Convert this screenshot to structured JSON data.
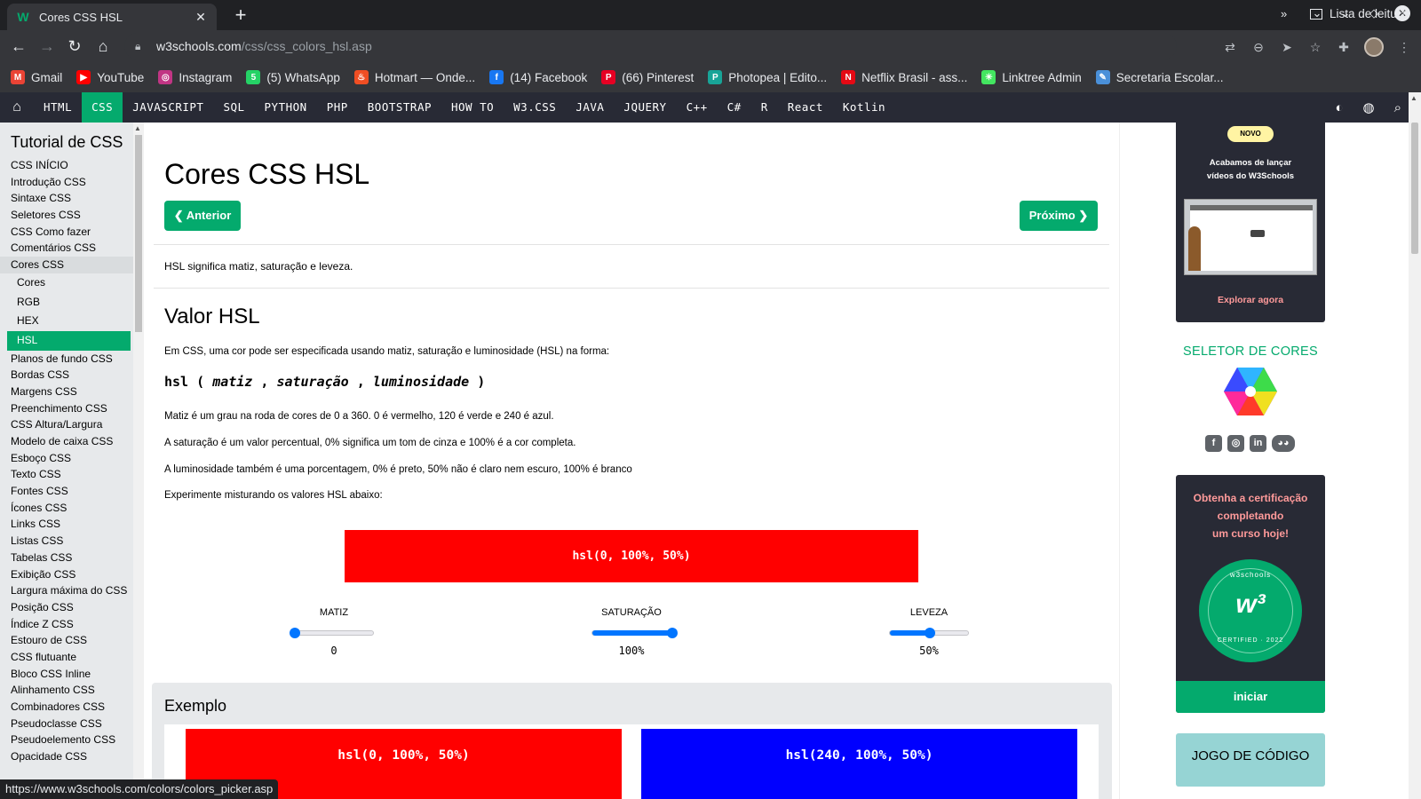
{
  "browser": {
    "tab_title": "Cores CSS HSL",
    "tab_favicon": "W",
    "url_host": "w3schools.com",
    "url_path": "/css/css_colors_hsl.asp",
    "status_url": "https://www.w3schools.com/colors/colors_picker.asp"
  },
  "bookmarks": [
    {
      "label": "Gmail",
      "icon": "gmail-icon",
      "color": "#ea4335",
      "glyph": "M"
    },
    {
      "label": "YouTube",
      "icon": "youtube-icon",
      "color": "#ff0000",
      "glyph": "▶"
    },
    {
      "label": "Instagram",
      "icon": "instagram-icon",
      "color": "#c13584",
      "glyph": "◎"
    },
    {
      "label": "(5) WhatsApp",
      "icon": "whatsapp-icon",
      "color": "#25d366",
      "glyph": "5"
    },
    {
      "label": "Hotmart — Onde...",
      "icon": "hotmart-icon",
      "color": "#f04e23",
      "glyph": "♨"
    },
    {
      "label": "(14) Facebook",
      "icon": "facebook-icon",
      "color": "#1877f2",
      "glyph": "f"
    },
    {
      "label": "(66) Pinterest",
      "icon": "pinterest-icon",
      "color": "#e60023",
      "glyph": "P"
    },
    {
      "label": "Photopea | Edito...",
      "icon": "photopea-icon",
      "color": "#18a497",
      "glyph": "P"
    },
    {
      "label": "Netflix Brasil - ass...",
      "icon": "netflix-icon",
      "color": "#e50914",
      "glyph": "N"
    },
    {
      "label": "Linktree Admin",
      "icon": "linktree-icon",
      "color": "#43e660",
      "glyph": "✳"
    },
    {
      "label": "Secretaria Escolar...",
      "icon": "secretaria-icon",
      "color": "#4a90d9",
      "glyph": "✎"
    }
  ],
  "bookmarks_more": "»",
  "reading_list": "Lista de leitura",
  "w3nav": [
    "HTML",
    "CSS",
    "JAVASCRIPT",
    "SQL",
    "PYTHON",
    "PHP",
    "BOOTSTRAP",
    "HOW TO",
    "W3.CSS",
    "JAVA",
    "JQUERY",
    "C++",
    "C#",
    "R",
    "React",
    "Kotlin"
  ],
  "sidebar": {
    "heading": "Tutorial de CSS",
    "items_before": [
      "CSS INÍCIO",
      "Introdução CSS",
      "Sintaxe CSS",
      "Seletores CSS",
      "CSS Como fazer",
      "Comentários CSS"
    ],
    "open_item": "Cores CSS",
    "sub_items": [
      "Cores",
      "RGB",
      "HEX",
      "HSL"
    ],
    "selected_sub": "HSL",
    "items_after": [
      "Planos de fundo CSS",
      "Bordas CSS",
      "Margens CSS",
      "Preenchimento CSS",
      "CSS Altura/Largura",
      "Modelo de caixa CSS",
      "Esboço CSS",
      "Texto CSS",
      "Fontes CSS",
      "Ícones CSS",
      "Links CSS",
      "Listas CSS",
      "Tabelas CSS",
      "Exibição CSS",
      "Largura máxima do CSS",
      "Posição CSS",
      "Índice Z CSS",
      "Estouro de CSS",
      "CSS flutuante",
      "Bloco CSS Inline",
      "Alinhamento CSS",
      "Combinadores CSS",
      "Pseudoclasse CSS",
      "Pseudoelemento CSS",
      "Opacidade CSS"
    ]
  },
  "main": {
    "title": "Cores CSS HSL",
    "prev_label": "❮ Anterior",
    "next_label": "Próximo ❯",
    "intro": "HSL significa matiz, saturação e leveza.",
    "section_title": "Valor HSL",
    "p1": "Em CSS, uma cor pode ser especificada usando matiz, saturação e luminosidade (HSL) na forma:",
    "syntax_open": "hsl (",
    "syntax_h": "matiz",
    "syntax_s": "saturação",
    "syntax_l": "luminosidade",
    "syntax_close": ")",
    "p2": "Matiz é um grau na roda de cores de 0 a 360. 0 é vermelho, 120 é verde e 240 é azul.",
    "p3": "A saturação é um valor percentual, 0% significa um tom de cinza e 100% é a cor completa.",
    "p4": "A luminosidade também é uma porcentagem, 0% é preto, 50% não é claro nem escuro, 100% é branco",
    "p5": "Experimente misturando os valores HSL abaixo:",
    "swatch_label": "hsl(0, 100%, 50%)",
    "swatch_color": "#ff0000",
    "sliders": [
      {
        "label": "MATIZ",
        "value": "0",
        "fraction": 0.0
      },
      {
        "label": "SATURAÇÃO",
        "value": "100%",
        "fraction": 1.0
      },
      {
        "label": "LEVEZA",
        "value": "50%",
        "fraction": 0.5
      }
    ],
    "example_title": "Exemplo",
    "examples": [
      {
        "label": "hsl(0, 100%, 50%)",
        "color": "#ff0000"
      },
      {
        "label": "hsl(240, 100%, 50%)",
        "color": "#0000ff"
      }
    ]
  },
  "right": {
    "badge_new": "NOVO",
    "promo_line1": "Acabamos de lançar",
    "promo_line2": "vídeos do W3Schools",
    "promo_link": "Explorar agora",
    "color_picker_title": "SELETOR DE CORES",
    "cert_line1": "Obtenha a certificação",
    "cert_line2": "completando",
    "cert_line3": "um curso hoje!",
    "badge_top": "w3schools",
    "badge_bottom": "CERTIFIED · 2022",
    "badge_mark": "w³",
    "cert_button": "iniciar",
    "code_game": "JOGO DE CÓDIGO"
  },
  "colors": {
    "accent_green": "#04aa6d",
    "nav_dark": "#282a35",
    "link_pink": "#ff9a9a"
  }
}
